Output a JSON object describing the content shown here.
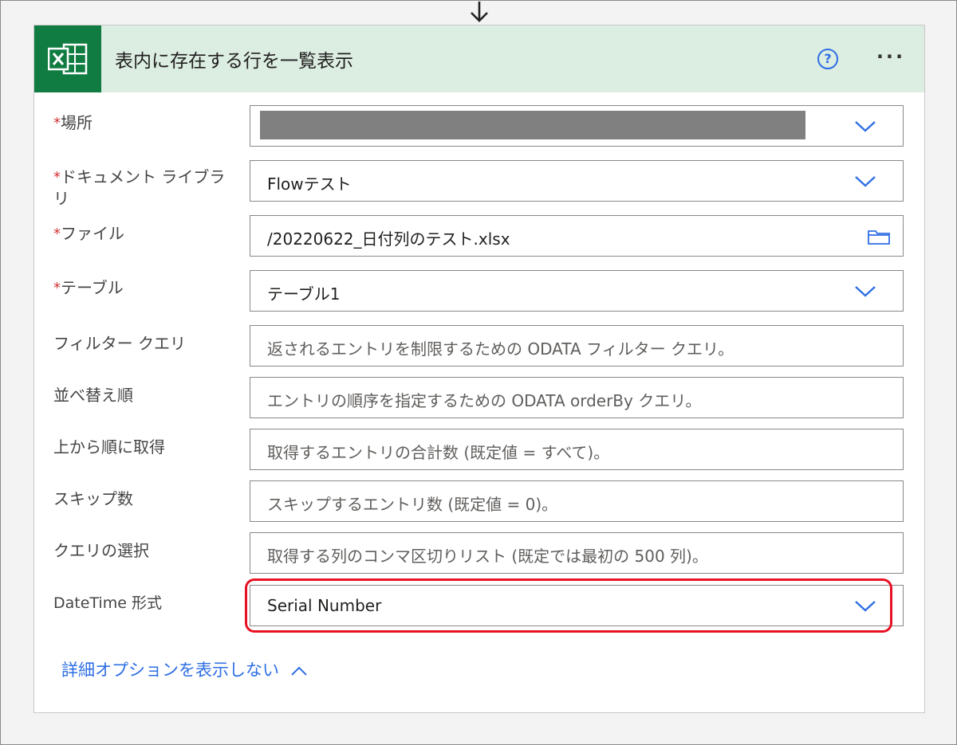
{
  "action": {
    "title": "表内に存在する行を一覧表示",
    "help_icon": "?",
    "more_icon": "···"
  },
  "fields": [
    {
      "label": "場所",
      "required": true,
      "value": "",
      "redacted": true,
      "control": "dropdown"
    },
    {
      "label": "ドキュメント ライブラリ",
      "required": true,
      "value": "Flowテスト",
      "control": "dropdown"
    },
    {
      "label": "ファイル",
      "required": true,
      "value": "/20220622_日付列のテスト.xlsx",
      "control": "file-picker"
    },
    {
      "label": "テーブル",
      "required": true,
      "value": "テーブル1",
      "control": "dropdown"
    },
    {
      "label": "フィルター クエリ",
      "required": false,
      "placeholder": "返されるエントリを制限するための ODATA フィルター クエリ。",
      "control": "text"
    },
    {
      "label": "並べ替え順",
      "required": false,
      "placeholder": "エントリの順序を指定するための ODATA orderBy クエリ。",
      "control": "text"
    },
    {
      "label": "上から順に取得",
      "required": false,
      "placeholder": "取得するエントリの合計数 (既定値 = すべて)。",
      "control": "text"
    },
    {
      "label": "スキップ数",
      "required": false,
      "placeholder": "スキップするエントリ数 (既定値 = 0)。",
      "control": "text"
    },
    {
      "label": "クエリの選択",
      "required": false,
      "placeholder": "取得する列のコンマ区切りリスト (既定では最初の 500 列)。",
      "control": "text"
    },
    {
      "label": "DateTime 形式",
      "required": false,
      "value": "Serial Number",
      "control": "dropdown",
      "highlighted": true
    }
  ],
  "required_marker": "*",
  "toggle_advanced": {
    "label": "詳細オプションを表示しない"
  },
  "colors": {
    "excel_green": "#107c41",
    "header_bg": "#dcede2",
    "link_blue": "#2f6fe4",
    "required_red": "#d13438",
    "highlight_red": "#e81123"
  }
}
